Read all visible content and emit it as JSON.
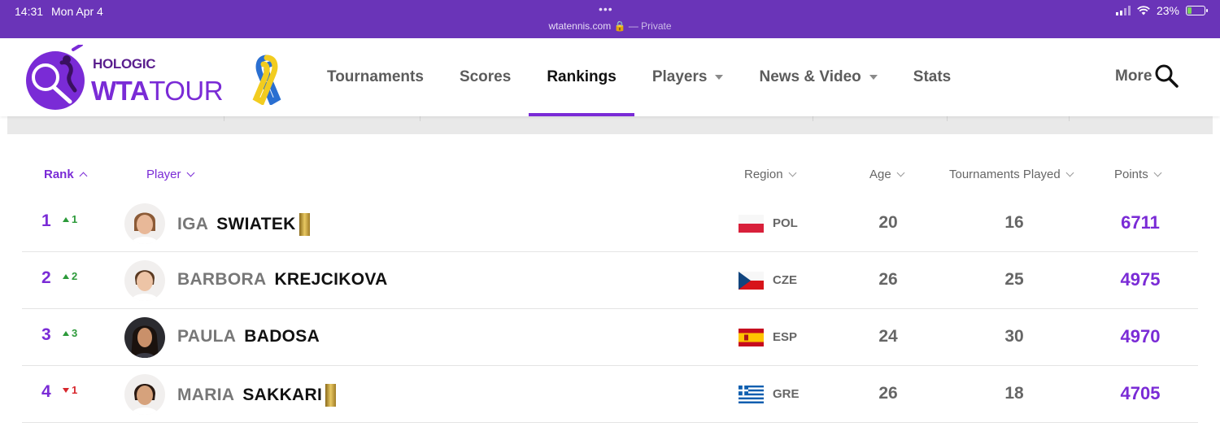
{
  "status_bar": {
    "time": "14:31",
    "date": "Mon Apr 4",
    "url": "wtatennis.com",
    "private_label": "— Private",
    "battery": "23%"
  },
  "logo": {
    "sponsor": "HOLOGIC",
    "wta": "WTA",
    "tour": "TOUR"
  },
  "nav": {
    "items": [
      {
        "label": "Tournaments",
        "dropdown": false,
        "active": false
      },
      {
        "label": "Scores",
        "dropdown": false,
        "active": false
      },
      {
        "label": "Rankings",
        "dropdown": false,
        "active": true
      },
      {
        "label": "Players",
        "dropdown": true,
        "active": false
      },
      {
        "label": "News & Video",
        "dropdown": true,
        "active": false
      },
      {
        "label": "Stats",
        "dropdown": false,
        "active": false
      }
    ],
    "more": "More"
  },
  "table": {
    "headers": {
      "rank": "Rank",
      "player": "Player",
      "region": "Region",
      "age": "Age",
      "played": "Tournaments Played",
      "points": "Points"
    },
    "rows": [
      {
        "rank": "1",
        "move": "1",
        "direction": "up",
        "first": "IGA",
        "last": "SWIATEK",
        "gold": true,
        "flag": "POL",
        "country": "POL",
        "age": "20",
        "played": "16",
        "points": "6711"
      },
      {
        "rank": "2",
        "move": "2",
        "direction": "up",
        "first": "BARBORA",
        "last": "KREJCIKOVA",
        "gold": false,
        "flag": "CZE",
        "country": "CZE",
        "age": "26",
        "played": "25",
        "points": "4975"
      },
      {
        "rank": "3",
        "move": "3",
        "direction": "up",
        "first": "PAULA",
        "last": "BADOSA",
        "gold": false,
        "flag": "ESP",
        "country": "ESP",
        "age": "24",
        "played": "30",
        "points": "4970"
      },
      {
        "rank": "4",
        "move": "1",
        "direction": "down",
        "first": "MARIA",
        "last": "SAKKARI",
        "gold": true,
        "flag": "GRE",
        "country": "GRE",
        "age": "26",
        "played": "18",
        "points": "4705"
      }
    ]
  },
  "colors": {
    "brand_purple": "#7a2bd6",
    "status_bar": "#6a34b8",
    "rank_up": "#2c9a3a",
    "rank_down": "#d7262c"
  }
}
